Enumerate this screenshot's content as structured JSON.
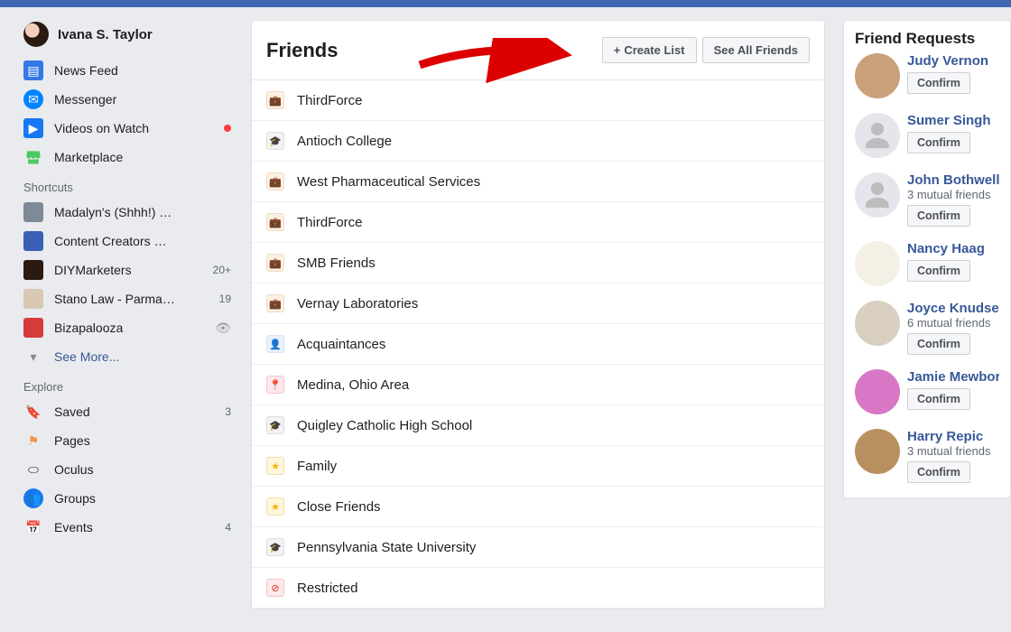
{
  "profile": {
    "name": "Ivana S. Taylor"
  },
  "nav": {
    "feed": "News Feed",
    "messenger": "Messenger",
    "videos": "Videos on Watch",
    "marketplace": "Marketplace"
  },
  "shortcuts_hd": "Shortcuts",
  "shortcuts": [
    {
      "label": "Madalyn's (Shhh!) …",
      "badge": ""
    },
    {
      "label": "Content Creators …",
      "badge": ""
    },
    {
      "label": "DIYMarketers",
      "badge": "20+"
    },
    {
      "label": "Stano Law - Parma…",
      "badge": "19"
    },
    {
      "label": "Bizapalooza",
      "badge": ""
    }
  ],
  "see_more": "See More...",
  "explore_hd": "Explore",
  "explore": {
    "saved": {
      "label": "Saved",
      "badge": "3"
    },
    "pages": {
      "label": "Pages",
      "badge": ""
    },
    "oculus": {
      "label": "Oculus",
      "badge": ""
    },
    "groups": {
      "label": "Groups",
      "badge": ""
    },
    "events": {
      "label": "Events",
      "badge": "4"
    }
  },
  "friends": {
    "title": "Friends",
    "create_btn": "Create List",
    "see_all_btn": "See All Friends",
    "lists": [
      {
        "icon": "brief",
        "label": "ThirdForce"
      },
      {
        "icon": "grad",
        "label": "Antioch College"
      },
      {
        "icon": "brief",
        "label": "West Pharmaceutical Services"
      },
      {
        "icon": "brief",
        "label": "ThirdForce"
      },
      {
        "icon": "brief",
        "label": "SMB Friends"
      },
      {
        "icon": "brief",
        "label": "Vernay Laboratories"
      },
      {
        "icon": "acq",
        "label": "Acquaintances"
      },
      {
        "icon": "pin",
        "label": "Medina, Ohio Area"
      },
      {
        "icon": "grad",
        "label": "Quigley Catholic High School"
      },
      {
        "icon": "star",
        "label": "Family"
      },
      {
        "icon": "star",
        "label": "Close Friends"
      },
      {
        "icon": "grad",
        "label": "Pennsylvania State University"
      },
      {
        "icon": "restr",
        "label": "Restricted"
      }
    ]
  },
  "requests": {
    "title": "Friend Requests",
    "confirm_btn": "Confirm",
    "items": [
      {
        "name": "Judy Vernon",
        "sub": ""
      },
      {
        "name": "Sumer Singh",
        "sub": ""
      },
      {
        "name": "John Bothwell",
        "sub": "3 mutual friends"
      },
      {
        "name": "Nancy Haag",
        "sub": ""
      },
      {
        "name": "Joyce Knudsen",
        "sub": "6 mutual friends"
      },
      {
        "name": "Jamie Mewborn",
        "sub": ""
      },
      {
        "name": "Harry Repic",
        "sub": "3 mutual friends"
      }
    ]
  }
}
